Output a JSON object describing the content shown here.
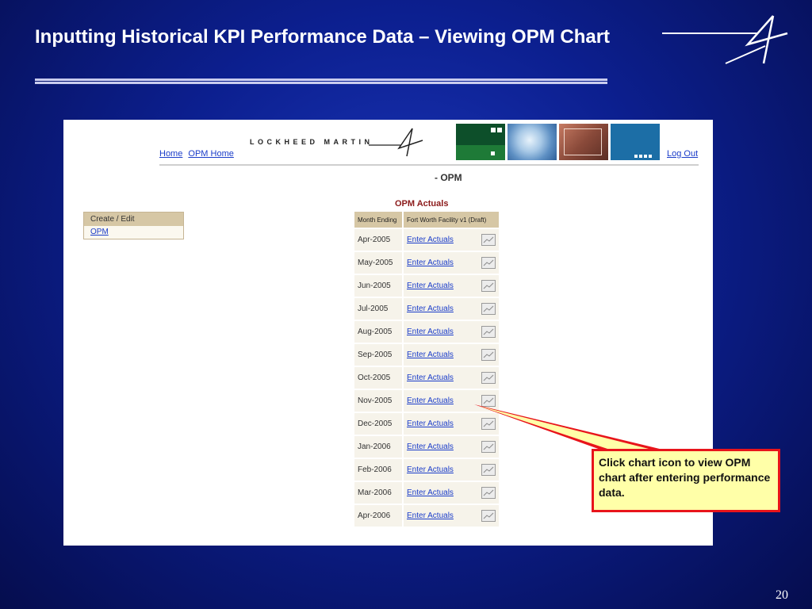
{
  "slide": {
    "title": "Inputting Historical KPI Performance Data – Viewing OPM Chart",
    "page_number": "20",
    "callout": "Click chart icon to view OPM chart after entering performance data."
  },
  "app": {
    "brand": "LOCKHEED MARTIN",
    "nav": {
      "home": "Home",
      "opm_home": "OPM Home",
      "logout": "Log Out"
    },
    "page_title": "- OPM",
    "sidebar": {
      "header": "Create / Edit",
      "items": [
        {
          "label": "OPM"
        }
      ]
    },
    "table": {
      "title": "OPM Actuals",
      "headers": [
        "Month Ending",
        "Fort Worth Facility v1 (Draft)"
      ],
      "rows": [
        {
          "month": "Apr-2005",
          "action": "Enter Actuals"
        },
        {
          "month": "May-2005",
          "action": "Enter Actuals"
        },
        {
          "month": "Jun-2005",
          "action": "Enter Actuals"
        },
        {
          "month": "Jul-2005",
          "action": "Enter Actuals"
        },
        {
          "month": "Aug-2005",
          "action": "Enter Actuals"
        },
        {
          "month": "Sep-2005",
          "action": "Enter Actuals"
        },
        {
          "month": "Oct-2005",
          "action": "Enter Actuals"
        },
        {
          "month": "Nov-2005",
          "action": "Enter Actuals"
        },
        {
          "month": "Dec-2005",
          "action": "Enter Actuals"
        },
        {
          "month": "Jan-2006",
          "action": "Enter Actuals"
        },
        {
          "month": "Feb-2006",
          "action": "Enter Actuals"
        },
        {
          "month": "Mar-2006",
          "action": "Enter Actuals"
        },
        {
          "month": "Apr-2006",
          "action": "Enter Actuals"
        }
      ]
    }
  },
  "colors": {
    "background": "#0c1f8f",
    "callout_border": "#e8141b",
    "callout_fill": "#ffffa8",
    "link": "#1a3cc9"
  }
}
